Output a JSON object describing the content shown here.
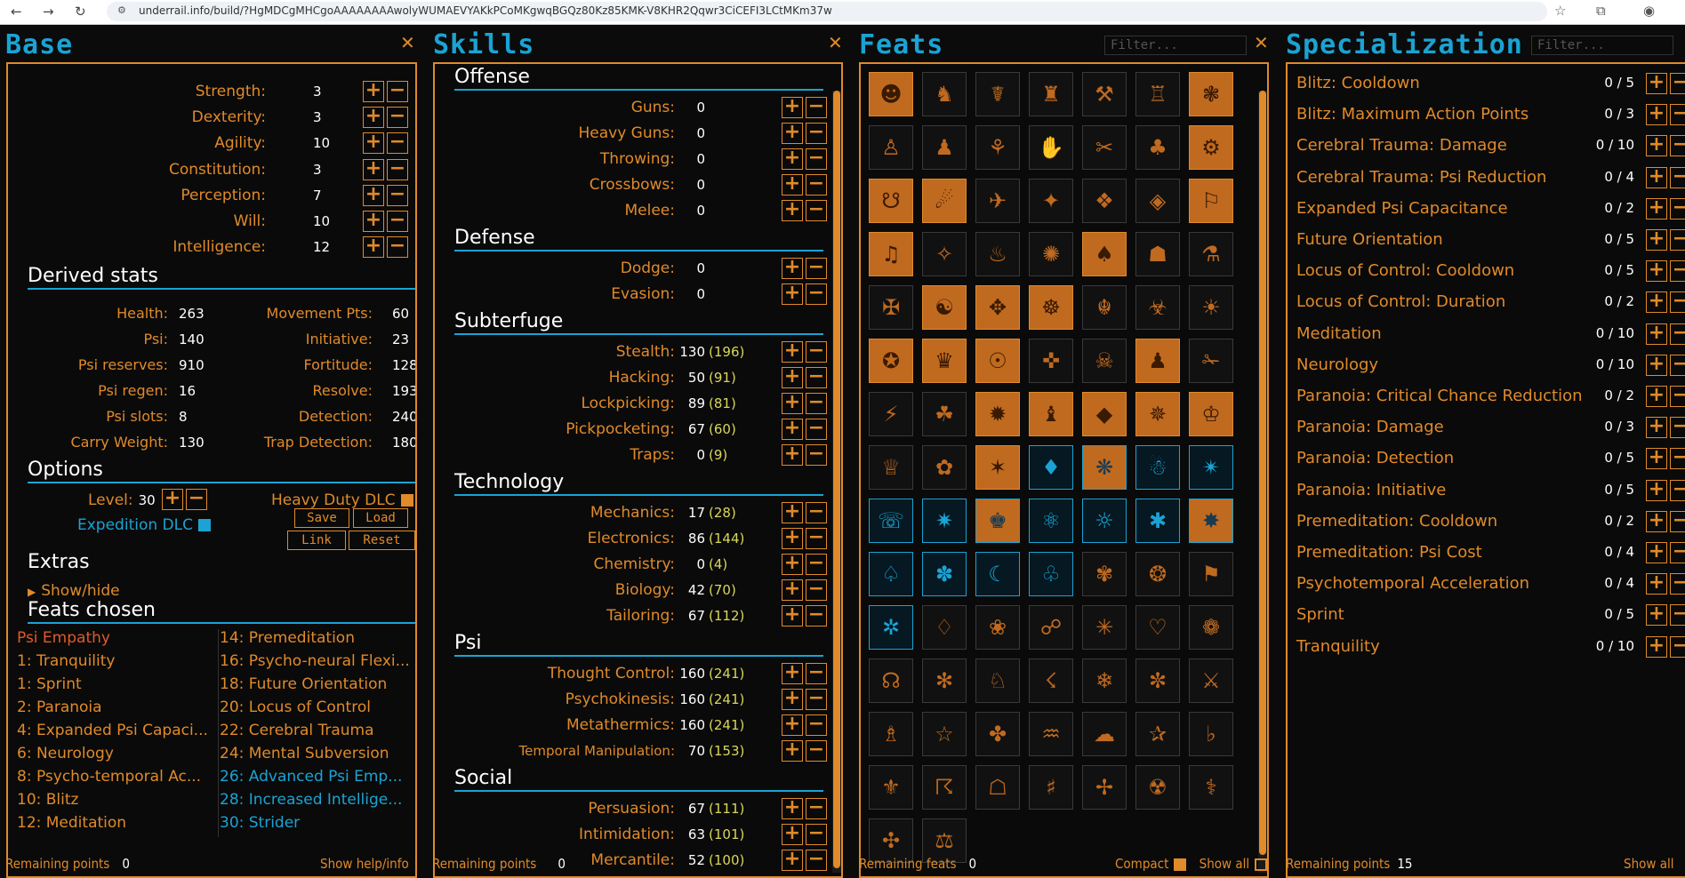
{
  "browser": {
    "url": "underrail.info/build/?HgMDCgMHCgoAAAAAAAAwolyWUMAEVYAKkPCoMKgwqBGQz80Kz85KMK-V8KHR2Qqwr3CiCEFI3LCtMKm37w"
  },
  "base": {
    "title": "Base",
    "attributes": [
      {
        "label": "Strength:",
        "value": "3"
      },
      {
        "label": "Dexterity:",
        "value": "3"
      },
      {
        "label": "Agility:",
        "value": "10"
      },
      {
        "label": "Constitution:",
        "value": "3"
      },
      {
        "label": "Perception:",
        "value": "7"
      },
      {
        "label": "Will:",
        "value": "10"
      },
      {
        "label": "Intelligence:",
        "value": "12"
      }
    ],
    "derived_title": "Derived stats",
    "derived_left": [
      {
        "label": "Health:",
        "value": "263"
      },
      {
        "label": "Psi:",
        "value": "140"
      },
      {
        "label": "Psi reserves:",
        "value": "910"
      },
      {
        "label": "Psi regen:",
        "value": "16"
      },
      {
        "label": "Psi slots:",
        "value": "8"
      },
      {
        "label": "Carry Weight:",
        "value": "130"
      }
    ],
    "derived_right": [
      {
        "label": "Movement Pts:",
        "value": "60"
      },
      {
        "label": "Initiative:",
        "value": "23"
      },
      {
        "label": "Fortitude:",
        "value": "128"
      },
      {
        "label": "Resolve:",
        "value": "193"
      },
      {
        "label": "Detection:",
        "value": "240"
      },
      {
        "label": "Trap Detection:",
        "value": "180"
      }
    ],
    "options_title": "Options",
    "level_label": "Level:",
    "level_value": "30",
    "heavy_duty": "Heavy Duty DLC",
    "expedition": "Expedition DLC",
    "save": "Save",
    "load": "Load",
    "link": "Link",
    "reset": "Reset",
    "extras_title": "Extras",
    "show_hide": "Show/hide",
    "feats_title": "Feats chosen",
    "feats_left": [
      {
        "t": "Psi Empathy",
        "c": "#e05a2a"
      },
      {
        "t": "1: Tranquility",
        "c": "#e08a2a"
      },
      {
        "t": "1: Sprint",
        "c": "#e08a2a"
      },
      {
        "t": "2: Paranoia",
        "c": "#e08a2a"
      },
      {
        "t": "4: Expanded Psi Capaci...",
        "c": "#e08a2a"
      },
      {
        "t": "6: Neurology",
        "c": "#e08a2a"
      },
      {
        "t": "8: Psycho-temporal Ac...",
        "c": "#e08a2a"
      },
      {
        "t": "10: Blitz",
        "c": "#e08a2a"
      },
      {
        "t": "12: Meditation",
        "c": "#e08a2a"
      }
    ],
    "feats_right": [
      {
        "t": "14: Premeditation",
        "c": "#e08a2a"
      },
      {
        "t": "16: Psycho-neural Flexi...",
        "c": "#e08a2a"
      },
      {
        "t": "18: Future Orientation",
        "c": "#e08a2a"
      },
      {
        "t": "20: Locus of Control",
        "c": "#e08a2a"
      },
      {
        "t": "22: Cerebral Trauma",
        "c": "#e08a2a"
      },
      {
        "t": "24: Mental Subversion",
        "c": "#e08a2a"
      },
      {
        "t": "26: Advanced Psi Emp...",
        "c": "#1aa3d4"
      },
      {
        "t": "28: Increased Intellige...",
        "c": "#1aa3d4"
      },
      {
        "t": "30: Strider",
        "c": "#1aa3d4"
      }
    ],
    "footer_label": "Remaining points",
    "footer_value": "0",
    "help": "Show help/info"
  },
  "skills": {
    "title": "Skills",
    "groups": [
      {
        "name": "Offense",
        "items": [
          [
            "Guns:",
            "0",
            ""
          ],
          [
            "Heavy Guns:",
            "0",
            ""
          ],
          [
            "Throwing:",
            "0",
            ""
          ],
          [
            "Crossbows:",
            "0",
            ""
          ],
          [
            "Melee:",
            "0",
            ""
          ]
        ]
      },
      {
        "name": "Defense",
        "items": [
          [
            "Dodge:",
            "0",
            ""
          ],
          [
            "Evasion:",
            "0",
            ""
          ]
        ]
      },
      {
        "name": "Subterfuge",
        "items": [
          [
            "Stealth:",
            "130",
            "(196)"
          ],
          [
            "Hacking:",
            "50",
            "(91)"
          ],
          [
            "Lockpicking:",
            "89",
            "(81)"
          ],
          [
            "Pickpocketing:",
            "67",
            "(60)"
          ],
          [
            "Traps:",
            "0",
            "(9)"
          ]
        ]
      },
      {
        "name": "Technology",
        "items": [
          [
            "Mechanics:",
            "17",
            "(28)"
          ],
          [
            "Electronics:",
            "86",
            "(144)"
          ],
          [
            "Chemistry:",
            "0",
            "(4)"
          ],
          [
            "Biology:",
            "42",
            "(70)"
          ],
          [
            "Tailoring:",
            "67",
            "(112)"
          ]
        ]
      },
      {
        "name": "Psi",
        "items": [
          [
            "Thought Control:",
            "160",
            "(241)"
          ],
          [
            "Psychokinesis:",
            "160",
            "(241)"
          ],
          [
            "Metathermics:",
            "160",
            "(241)"
          ],
          [
            "Temporal Manipulation:",
            "70",
            "(153)"
          ]
        ]
      },
      {
        "name": "Social",
        "items": [
          [
            "Persuasion:",
            "67",
            "(111)"
          ],
          [
            "Intimidation:",
            "63",
            "(101)"
          ],
          [
            "Mercantile:",
            "52",
            "(100)"
          ]
        ]
      }
    ],
    "footer_label": "Remaining points",
    "footer_value": "0"
  },
  "feats": {
    "title": "Feats",
    "filter_placeholder": "Filter...",
    "footer_label": "Remaining feats",
    "footer_value": "0",
    "compact": "Compact",
    "show_all": "Show all"
  },
  "spec": {
    "title": "Specialization",
    "filter_placeholder": "Filter...",
    "items": [
      [
        "Blitz: Cooldown",
        "0 / 5"
      ],
      [
        "Blitz: Maximum Action Points",
        "0 / 3"
      ],
      [
        "Cerebral Trauma: Damage",
        "0 / 10"
      ],
      [
        "Cerebral Trauma: Psi Reduction",
        "0 / 4"
      ],
      [
        "Expanded Psi Capacitance",
        "0 / 2"
      ],
      [
        "Future Orientation",
        "0 / 5"
      ],
      [
        "Locus of Control: Cooldown",
        "0 / 5"
      ],
      [
        "Locus of Control: Duration",
        "0 / 2"
      ],
      [
        "Meditation",
        "0 / 10"
      ],
      [
        "Neurology",
        "0 / 10"
      ],
      [
        "Paranoia: Critical Chance Reduction",
        "0 / 2"
      ],
      [
        "Paranoia: Damage",
        "0 / 3"
      ],
      [
        "Paranoia: Detection",
        "0 / 5"
      ],
      [
        "Paranoia: Initiative",
        "0 / 5"
      ],
      [
        "Premeditation: Cooldown",
        "0 / 2"
      ],
      [
        "Premeditation: Psi Cost",
        "0 / 4"
      ],
      [
        "Psychotemporal Acceleration",
        "0 / 4"
      ],
      [
        "Sprint",
        "0 / 5"
      ],
      [
        "Tranquility",
        "0 / 10"
      ]
    ],
    "footer_label": "Remaining points",
    "footer_value": "15",
    "show_all": "Show all"
  }
}
